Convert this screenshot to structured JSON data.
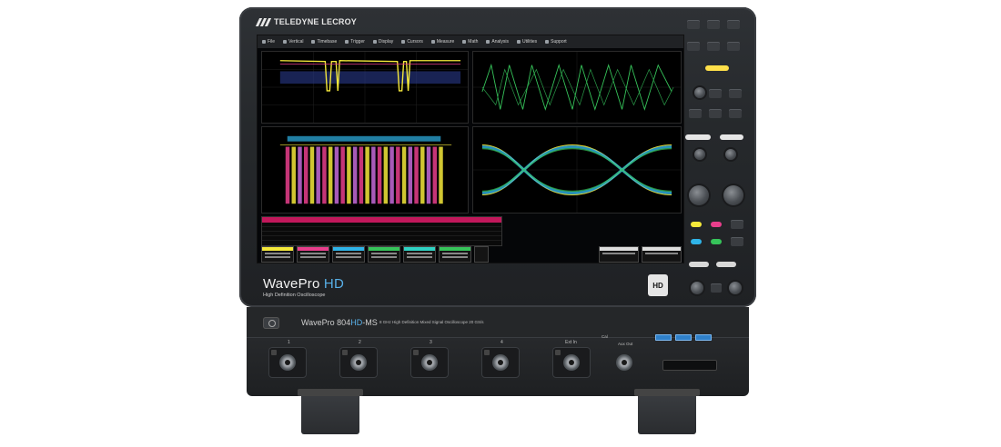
{
  "brand": "TELEDYNE LECROY",
  "model_line": {
    "prefix": "WavePro ",
    "accent": "HD"
  },
  "tagline": "High Definition Oscilloscope",
  "hd_badge": "HD",
  "menu": [
    "File",
    "Vertical",
    "Timebase",
    "Trigger",
    "Display",
    "Cursors",
    "Measure",
    "Math",
    "Analysis",
    "Utilities",
    "Support"
  ],
  "screen_brand": "TELEDYNE LECROY",
  "chassis": {
    "model_prefix": "WavePro 804",
    "model_accent": "HD",
    "model_suffix": "-MS",
    "description": "8 GHz High Definition Mixed Signal Oscilloscope  20 GS/s"
  },
  "inputs": [
    "1",
    "2",
    "3",
    "4",
    "Ext In"
  ],
  "aux_out_label": "Aux Out",
  "cal_label": "Cal",
  "colors": {
    "ch1": "#f5e93a",
    "ch2": "#e83e8c",
    "ch3": "#2fb4e8",
    "ch4": "#36c45a",
    "accent_blue": "#58b0e8",
    "usb_blue": "#2f80c9"
  }
}
